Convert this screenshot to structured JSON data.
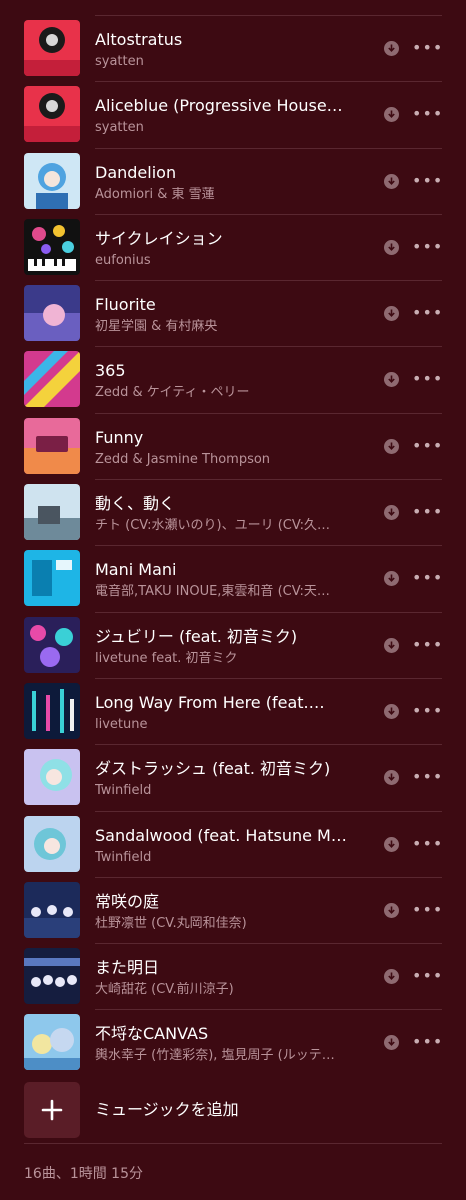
{
  "tracks": [
    {
      "title": "Altostratus",
      "artist": "syatten"
    },
    {
      "title": "Aliceblue (Progressive House…",
      "artist": "syatten"
    },
    {
      "title": "Dandelion",
      "artist": "Adomiori & 東 雪蓮"
    },
    {
      "title": "サイクレイション",
      "artist": "eufonius"
    },
    {
      "title": "Fluorite",
      "artist": "初星学園 & 有村麻央"
    },
    {
      "title": "365",
      "artist": "Zedd & ケイティ・ペリー"
    },
    {
      "title": "Funny",
      "artist": "Zedd & Jasmine Thompson"
    },
    {
      "title": "動く、動く",
      "artist": "チト (CV:水瀬いのり)、ユーリ (CV:久…"
    },
    {
      "title": "Mani Mani",
      "artist": "電音部,TAKU INOUE,東雲和音 (CV:天…"
    },
    {
      "title": "ジュビリー (feat. 初音ミク)",
      "artist": "livetune feat. 初音ミク"
    },
    {
      "title": "Long Way From Here (feat.…",
      "artist": "livetune"
    },
    {
      "title": "ダストラッシュ (feat. 初音ミク)",
      "artist": "Twinfield"
    },
    {
      "title": "Sandalwood (feat. Hatsune M…",
      "artist": "Twinfield"
    },
    {
      "title": "常咲の庭",
      "artist": "杜野凛世 (CV.丸岡和佳奈)"
    },
    {
      "title": "また明日",
      "artist": "大崎甜花 (CV.前川涼子)"
    },
    {
      "title": "不埒なCANVAS",
      "artist": "輿水幸子 (竹達彩奈), 塩見周子 (ルッテ…"
    }
  ],
  "more_label": "•••",
  "add_music_label": "ミュージックを追加",
  "summary": "16曲、1時間 15分",
  "colors": {
    "background": "#3d0a12",
    "separator": "#5a2730",
    "secondary_text": "#b9939a",
    "add_box": "#5a1d27"
  },
  "icons": {
    "download": "download-arrow-circle",
    "more": "ellipsis",
    "add": "plus"
  }
}
